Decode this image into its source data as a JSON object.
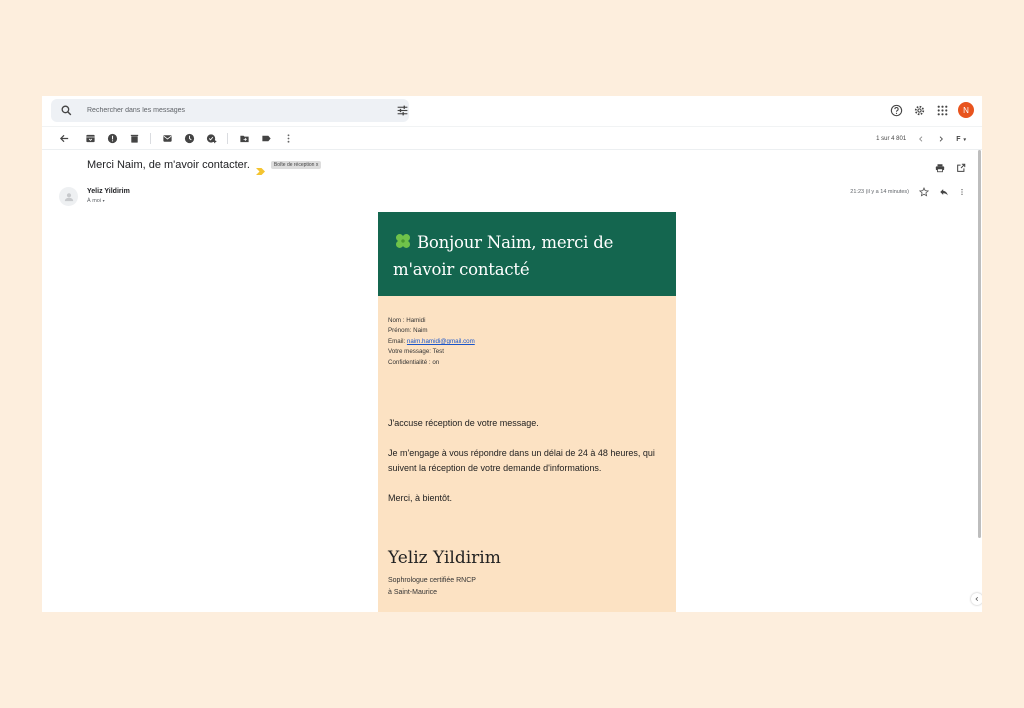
{
  "search": {
    "placeholder": "Rechercher dans les messages"
  },
  "account": {
    "avatar_letter": "N"
  },
  "toolbar": {
    "pagination": "1 sur 4 801",
    "input_tools": "F"
  },
  "message": {
    "subject": "Merci Naim, de m'avoir contacter.",
    "label": "Boîte de réception",
    "label_close": "x",
    "sender": "Yeliz Yildirim",
    "recipient": "À moi",
    "time": "21:23 (il y a 14 minutes)"
  },
  "email": {
    "header_line1": "Bonjour Naim, merci de",
    "header_line2": "m'avoir contacté",
    "fields": {
      "nom": "Nom : Hamidi",
      "prenom": "Prénom: Naim",
      "email_label": "Email: ",
      "email_value": "naim.hamidi@gmail.com",
      "message": "Votre message: Test",
      "confidentialite": "Confidentialité : on"
    },
    "para1": "J'accuse réception de votre message.",
    "para2": "Je m'engage à vous répondre dans un délai de 24 à 48 heures, qui suivent la réception de votre demande d'informations.",
    "para3": "Merci, à bientôt.",
    "signature_name": "Yeliz Yildirim",
    "signature_role": "Sophrologue certifiée RNCP",
    "signature_place": "à Saint-Maurice"
  },
  "colors": {
    "header_green": "#14664f",
    "card_bg": "#fce2c3",
    "page_bg": "#fdeedd",
    "avatar_orange": "#e8541e",
    "label_arrow": "#f4c430"
  },
  "icons": [
    "search-icon",
    "tune-icon",
    "help-icon",
    "settings-icon",
    "apps-icon",
    "back-icon",
    "archive-icon",
    "spam-icon",
    "delete-icon",
    "mark-unread-icon",
    "snooze-icon",
    "add-task-icon",
    "move-to-icon",
    "label-icon",
    "more-vert-icon",
    "chevron-left-icon",
    "chevron-right-icon",
    "print-icon",
    "open-new-window-icon",
    "star-icon",
    "reply-icon",
    "clover-icon"
  ]
}
